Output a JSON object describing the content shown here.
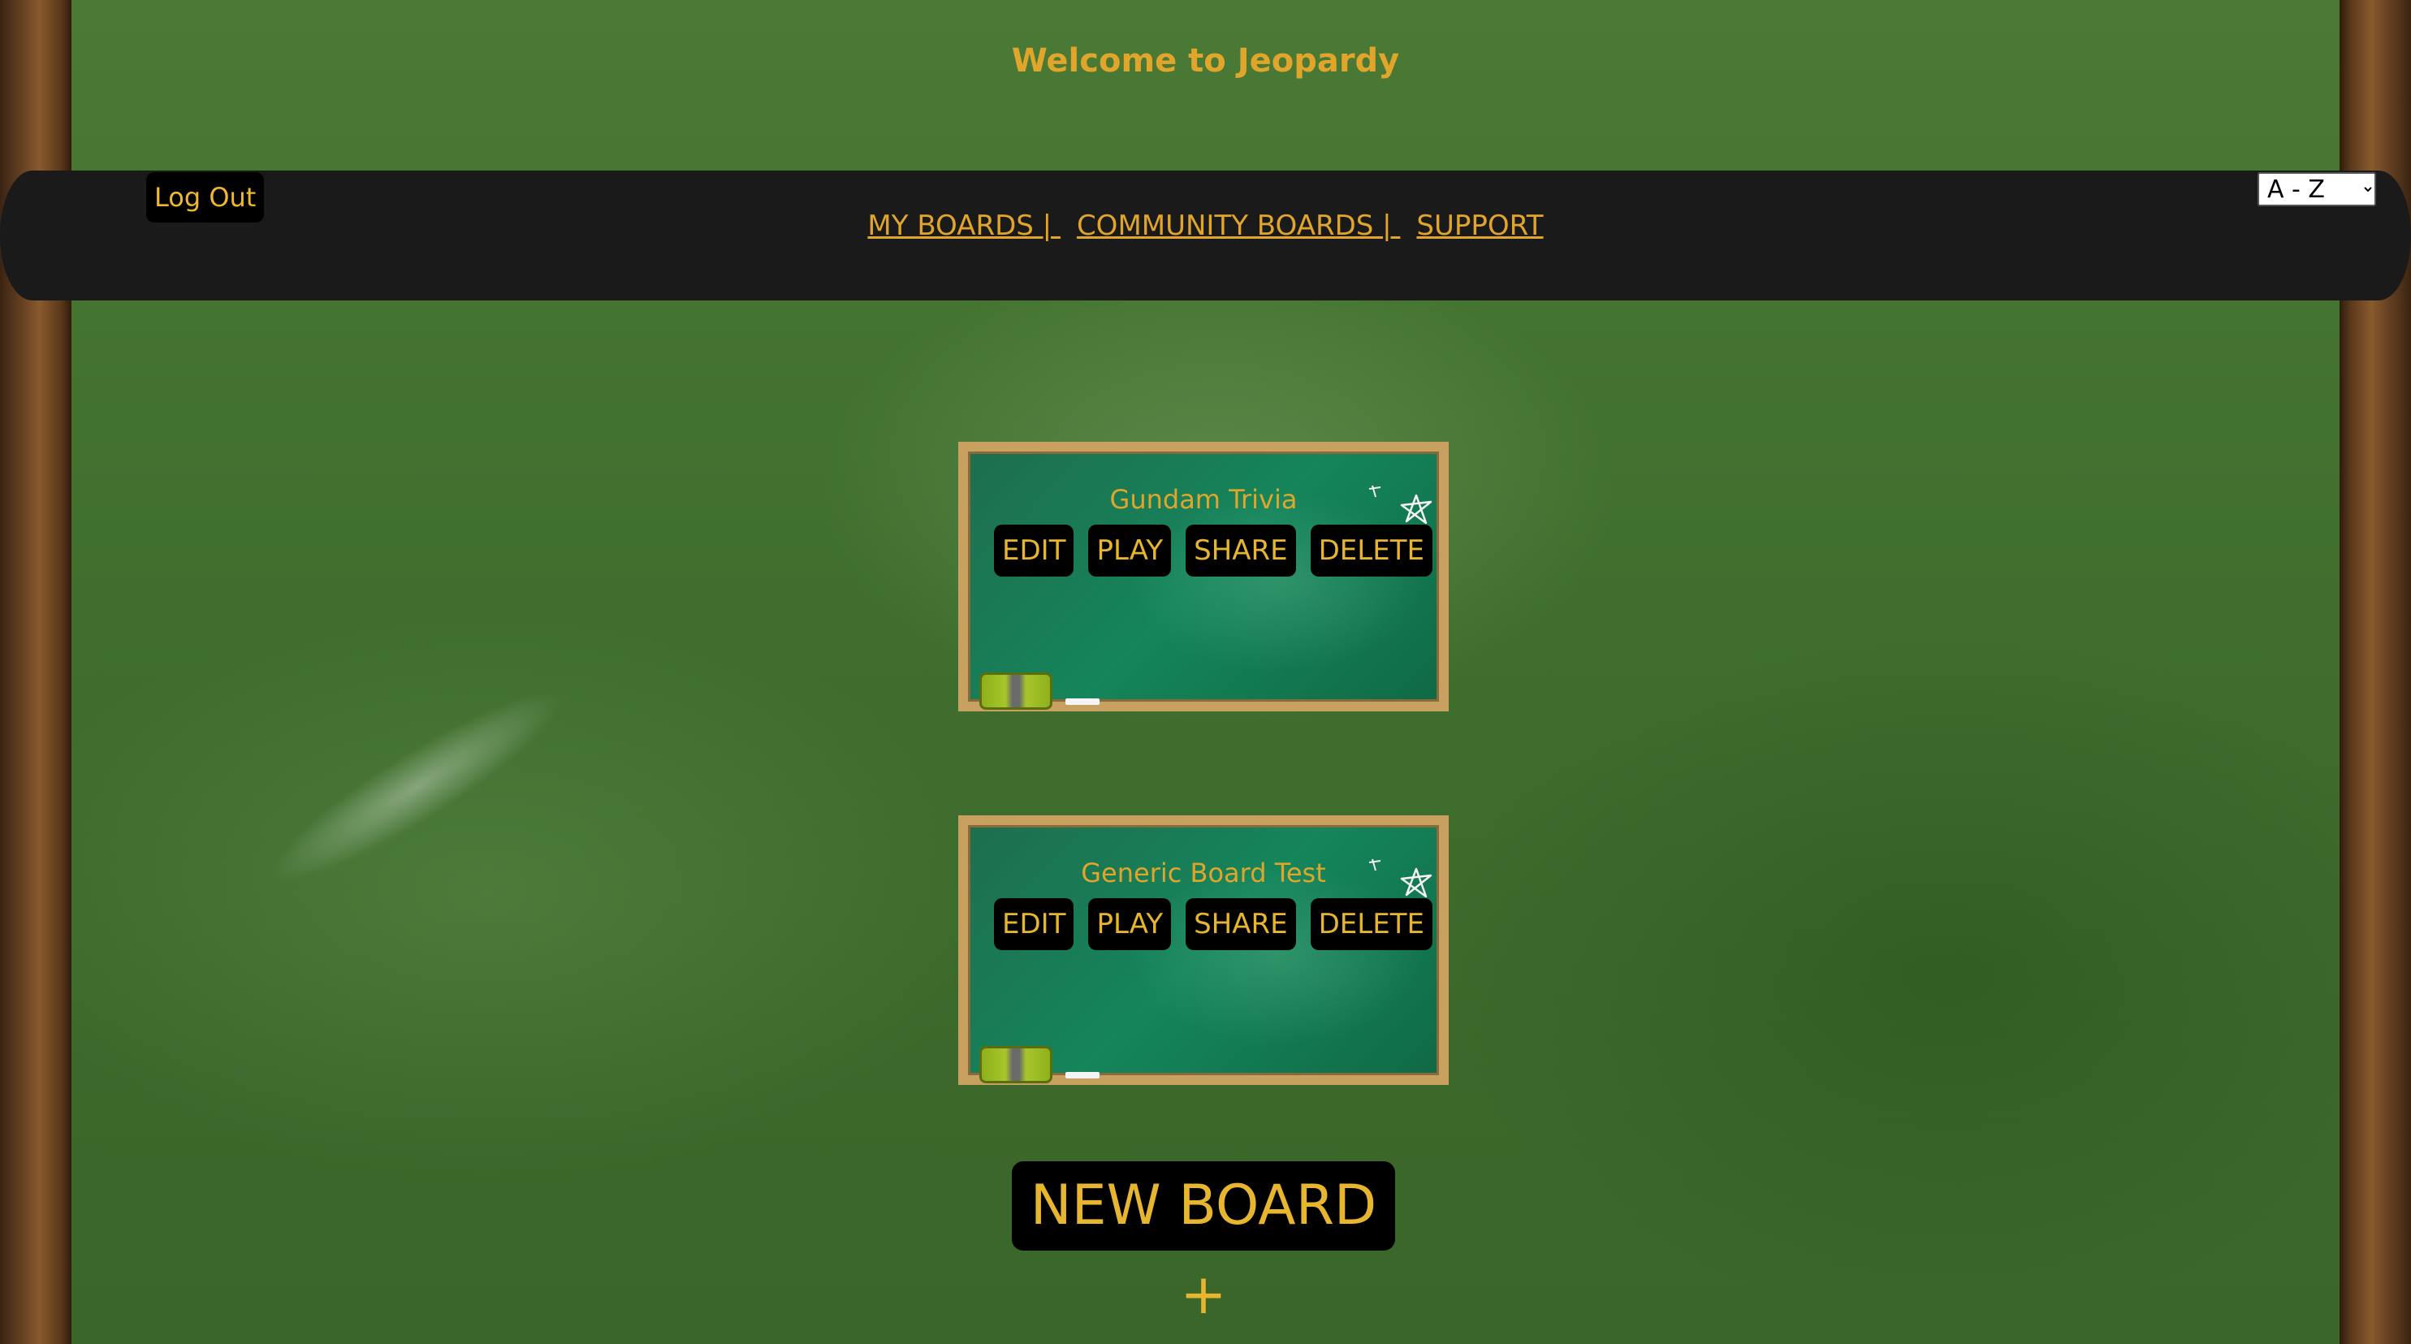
{
  "header": {
    "title": "Welcome to Jeopardy"
  },
  "navbar": {
    "logout_label": "Log Out",
    "links": [
      "MY BOARDS | ",
      "COMMUNITY BOARDS | ",
      "SUPPORT"
    ],
    "sort": {
      "selected": "A - Z"
    }
  },
  "boards": [
    {
      "name": "Gundam Trivia",
      "actions": [
        "EDIT",
        "PLAY",
        "SHARE",
        "DELETE"
      ]
    },
    {
      "name": "Generic Board Test",
      "actions": [
        "EDIT",
        "PLAY",
        "SHARE",
        "DELETE"
      ]
    }
  ],
  "new_board_label": "NEW BOARD +",
  "colors": {
    "accent": "#e0a52a",
    "navbar": "#1a1a1a",
    "card_border": "#c8a060",
    "button_bg": "#000000"
  }
}
